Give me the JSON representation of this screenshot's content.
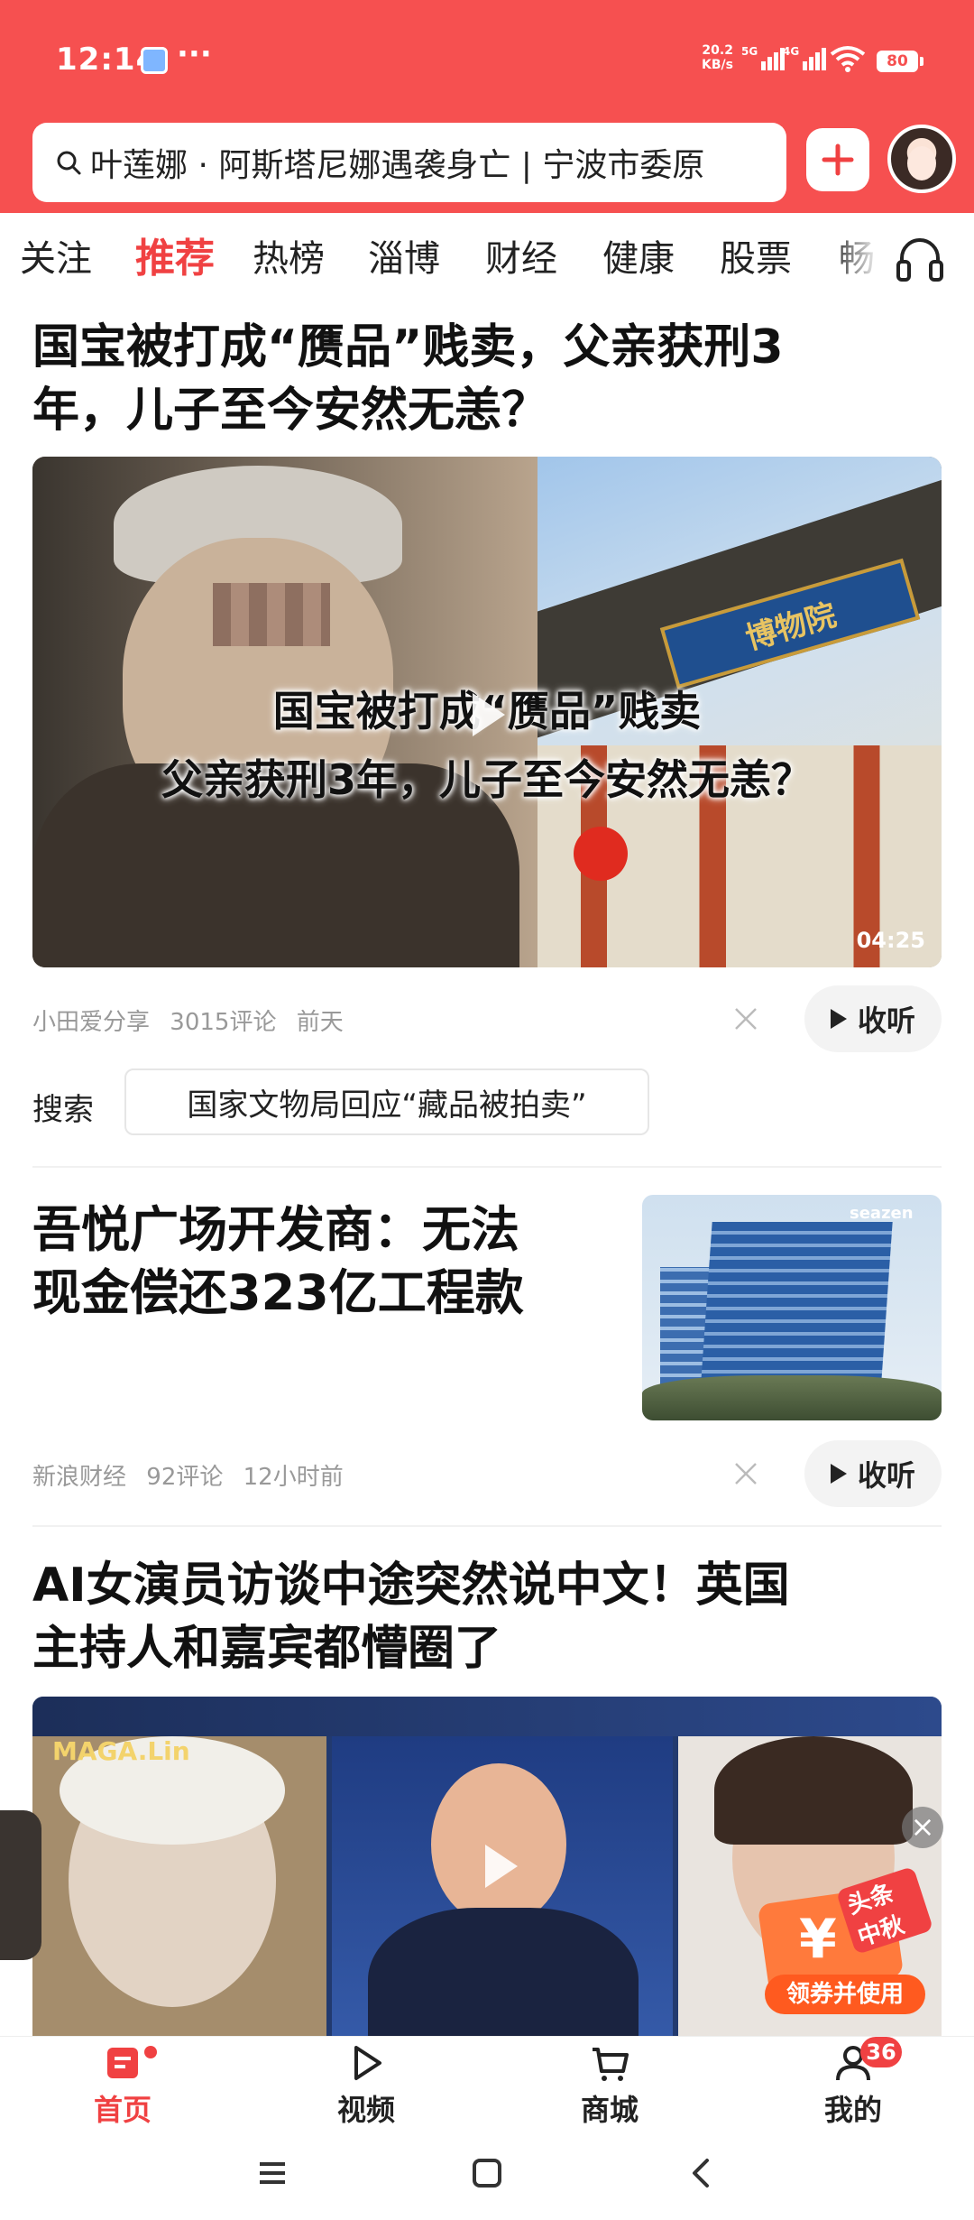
{
  "status_bar": {
    "time": "12:14",
    "more": "···",
    "net_speed_value": "20.2",
    "net_speed_unit": "KB/s",
    "sim1": "5G",
    "sim2": "4G",
    "battery": "80"
  },
  "header": {
    "search_query": "叶莲娜 · 阿斯塔尼娜遇袭身亡 | 宁波市委原",
    "colors": {
      "brand": "#f65050",
      "accent": "#f04142"
    }
  },
  "tabs": [
    "关注",
    "推荐",
    "热榜",
    "淄博",
    "财经",
    "健康",
    "股票",
    "畅"
  ],
  "active_tab": "推荐",
  "feed": {
    "card1": {
      "title_line1": "国宝被打成“赝品”贱卖，父亲获刑3",
      "title_line2": "年，儿子至今安然无恙？",
      "caption_line1": "国宝被打成“赝品”贱卖",
      "caption_line2": "父亲获刑3年，儿子至今安然无恙？",
      "duration": "04:25",
      "source": "小田爱分享",
      "comments": "3015评论",
      "time": "前天",
      "listen_label": "收听",
      "search_label": "搜索",
      "search_suggestion": "国家文物局回应“藏品被拍卖”"
    },
    "card2": {
      "title_line1": "吾悦广场开发商：无法",
      "title_line2": "现金偿还323亿工程款",
      "image_logo": "seazen",
      "source": "新浪财经",
      "comments": "92评论",
      "time": "12小时前",
      "listen_label": "收听"
    },
    "card3": {
      "title_line1": "AI女演员访谈中途突然说中文！英国",
      "title_line2": "主持人和嘉宾都懵圈了",
      "watermark": "MAGA.Lin",
      "ad_badge": "头条中秋",
      "ad_cta": "领券并使用",
      "ad_close": "×"
    }
  },
  "bottom_nav": {
    "items": [
      "首页",
      "视频",
      "商城",
      "我的"
    ],
    "active": "首页",
    "profile_badge": "36"
  }
}
